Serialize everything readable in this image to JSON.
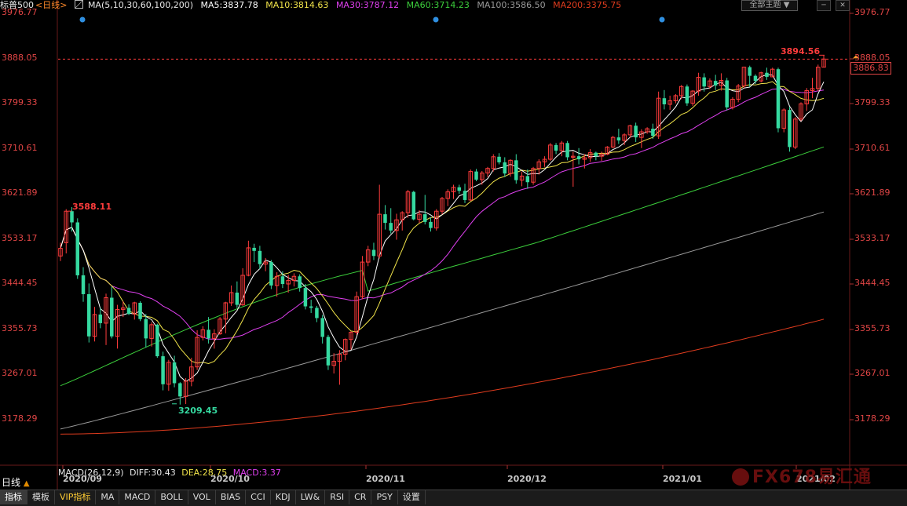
{
  "header": {
    "symbol": "标普500",
    "period_tag": "<日线>",
    "ma_title": "MA(5,10,30,60,100,200)",
    "ma5": "MA5:3837.78",
    "ma10": "MA10:3814.63",
    "ma30": "MA30:3787.12",
    "ma60": "MA60:3714.23",
    "ma100": "MA100:3586.50",
    "ma200": "MA200:3375.75",
    "theme_button": "全部主题",
    "dropdown_glyph": "▼",
    "minimize_glyph": "─",
    "close_glyph": "✕"
  },
  "colors": {
    "up": "#ff3c3c",
    "down": "#35d9a0",
    "ma5": "#ffffff",
    "ma10": "#f0e34a",
    "ma30": "#e040f0",
    "ma60": "#3ccf3c",
    "ma100": "#9a9a9a",
    "ma200": "#e03c1e"
  },
  "y_axis": {
    "ticks": [
      "3976.77",
      "3888.05",
      "3799.33",
      "3710.61",
      "3621.89",
      "3533.17",
      "3444.45",
      "3355.73",
      "3267.01",
      "3178.29"
    ]
  },
  "x_axis": {
    "labels": [
      "2020/09",
      "2020/10",
      "2020/11",
      "2020/12",
      "2021/01",
      "2021/02"
    ]
  },
  "current_price": "3886.83",
  "annotations": {
    "high_label": "3894.56",
    "left_high_label": "3588.11",
    "low_label": "3209.45"
  },
  "macd": {
    "title": "MACD(26,12,9)",
    "diff": "DIFF:30.43",
    "dea": "DEA:28.75",
    "macd": "MACD:3.37"
  },
  "period_label": "日线",
  "period_glyph": "▲",
  "tabs": [
    "指标",
    "模板",
    "VIP指标",
    "MA",
    "MACD",
    "BOLL",
    "VOL",
    "BIAS",
    "CCI",
    "KDJ",
    "LW&",
    "RSI",
    "CR",
    "PSY",
    "设置"
  ],
  "watermark": "FX678易汇通",
  "chart_data": {
    "type": "candlestick",
    "y_range": [
      3130,
      3990
    ],
    "candles": [
      [
        3500,
        3526,
        3490,
        3515
      ],
      [
        3526,
        3592,
        3505,
        3588
      ],
      [
        3588,
        3596,
        3548,
        3566
      ],
      [
        3566,
        3574,
        3455,
        3462
      ],
      [
        3462,
        3478,
        3410,
        3425
      ],
      [
        3425,
        3446,
        3330,
        3342
      ],
      [
        3342,
        3400,
        3332,
        3385
      ],
      [
        3385,
        3398,
        3358,
        3368
      ],
      [
        3368,
        3426,
        3325,
        3418
      ],
      [
        3418,
        3440,
        3338,
        3342
      ],
      [
        3342,
        3404,
        3318,
        3395
      ],
      [
        3395,
        3411,
        3380,
        3398
      ],
      [
        3398,
        3405,
        3384,
        3386
      ],
      [
        3386,
        3410,
        3375,
        3408
      ],
      [
        3408,
        3411,
        3372,
        3376
      ],
      [
        3376,
        3386,
        3320,
        3338
      ],
      [
        3338,
        3370,
        3322,
        3365
      ],
      [
        3365,
        3367,
        3300,
        3303
      ],
      [
        3303,
        3312,
        3236,
        3248
      ],
      [
        3248,
        3296,
        3235,
        3291
      ],
      [
        3291,
        3304,
        3242,
        3250
      ],
      [
        3250,
        3252,
        3208,
        3224
      ],
      [
        3224,
        3260,
        3209,
        3254
      ],
      [
        3254,
        3300,
        3244,
        3282
      ],
      [
        3282,
        3354,
        3276,
        3340
      ],
      [
        3340,
        3362,
        3334,
        3355
      ],
      [
        3355,
        3380,
        3328,
        3338
      ],
      [
        3338,
        3356,
        3318,
        3347
      ],
      [
        3347,
        3380,
        3345,
        3376
      ],
      [
        3376,
        3410,
        3348,
        3408
      ],
      [
        3408,
        3442,
        3402,
        3428
      ],
      [
        3428,
        3450,
        3398,
        3404
      ],
      [
        3404,
        3476,
        3402,
        3462
      ],
      [
        3462,
        3530,
        3460,
        3516
      ],
      [
        3516,
        3524,
        3488,
        3510
      ],
      [
        3510,
        3520,
        3474,
        3484
      ],
      [
        3484,
        3496,
        3470,
        3488
      ],
      [
        3488,
        3492,
        3435,
        3442
      ],
      [
        3442,
        3468,
        3420,
        3460
      ],
      [
        3460,
        3470,
        3437,
        3445
      ],
      [
        3445,
        3463,
        3428,
        3452
      ],
      [
        3452,
        3466,
        3440,
        3460
      ],
      [
        3460,
        3464,
        3430,
        3437
      ],
      [
        3437,
        3445,
        3395,
        3401
      ],
      [
        3401,
        3414,
        3388,
        3398
      ],
      [
        3398,
        3402,
        3370,
        3378
      ],
      [
        3378,
        3384,
        3328,
        3341
      ],
      [
        3341,
        3345,
        3276,
        3285
      ],
      [
        3285,
        3309,
        3269,
        3293
      ],
      [
        3293,
        3315,
        3247,
        3307
      ],
      [
        3307,
        3338,
        3295,
        3336
      ],
      [
        3336,
        3352,
        3316,
        3350
      ],
      [
        3350,
        3430,
        3345,
        3420
      ],
      [
        3420,
        3500,
        3415,
        3488
      ],
      [
        3488,
        3520,
        3480,
        3512
      ],
      [
        3512,
        3526,
        3492,
        3500
      ],
      [
        3500,
        3640,
        3495,
        3582
      ],
      [
        3582,
        3600,
        3552,
        3565
      ],
      [
        3565,
        3594,
        3544,
        3550
      ],
      [
        3550,
        3583,
        3532,
        3571
      ],
      [
        3571,
        3588,
        3550,
        3585
      ],
      [
        3585,
        3630,
        3575,
        3626
      ],
      [
        3626,
        3628,
        3570,
        3572
      ],
      [
        3572,
        3590,
        3565,
        3582
      ],
      [
        3582,
        3620,
        3562,
        3567
      ],
      [
        3567,
        3576,
        3548,
        3555
      ],
      [
        3555,
        3592,
        3550,
        3588
      ],
      [
        3588,
        3616,
        3582,
        3613
      ],
      [
        3613,
        3631,
        3598,
        3626
      ],
      [
        3626,
        3640,
        3612,
        3635
      ],
      [
        3635,
        3640,
        3622,
        3628
      ],
      [
        3628,
        3642,
        3604,
        3610
      ],
      [
        3610,
        3670,
        3608,
        3666
      ],
      [
        3666,
        3671,
        3647,
        3650
      ],
      [
        3650,
        3667,
        3640,
        3663
      ],
      [
        3663,
        3675,
        3655,
        3672
      ],
      [
        3672,
        3700,
        3666,
        3695
      ],
      [
        3695,
        3702,
        3680,
        3684
      ],
      [
        3684,
        3694,
        3655,
        3662
      ],
      [
        3662,
        3690,
        3656,
        3688
      ],
      [
        3688,
        3700,
        3642,
        3649
      ],
      [
        3649,
        3666,
        3637,
        3657
      ],
      [
        3657,
        3670,
        3632,
        3645
      ],
      [
        3645,
        3675,
        3640,
        3672
      ],
      [
        3672,
        3690,
        3660,
        3685
      ],
      [
        3685,
        3696,
        3675,
        3690
      ],
      [
        3690,
        3722,
        3687,
        3718
      ],
      [
        3718,
        3722,
        3700,
        3707
      ],
      [
        3707,
        3726,
        3696,
        3722
      ],
      [
        3722,
        3726,
        3688,
        3694
      ],
      [
        3694,
        3705,
        3636,
        3696
      ],
      [
        3696,
        3712,
        3680,
        3690
      ],
      [
        3690,
        3700,
        3672,
        3693
      ],
      [
        3693,
        3710,
        3685,
        3703
      ],
      [
        3703,
        3705,
        3688,
        3696
      ],
      [
        3696,
        3705,
        3687,
        3700
      ],
      [
        3700,
        3716,
        3698,
        3714
      ],
      [
        3714,
        3736,
        3712,
        3733
      ],
      [
        3733,
        3750,
        3720,
        3727
      ],
      [
        3727,
        3741,
        3718,
        3738
      ],
      [
        3738,
        3758,
        3732,
        3756
      ],
      [
        3756,
        3762,
        3724,
        3733
      ],
      [
        3733,
        3749,
        3712,
        3744
      ],
      [
        3744,
        3753,
        3740,
        3750
      ],
      [
        3750,
        3760,
        3730,
        3736
      ],
      [
        3736,
        3823,
        3730,
        3810
      ],
      [
        3810,
        3826,
        3788,
        3798
      ],
      [
        3798,
        3815,
        3787,
        3805
      ],
      [
        3805,
        3818,
        3800,
        3815
      ],
      [
        3815,
        3836,
        3808,
        3833
      ],
      [
        3833,
        3837,
        3795,
        3800
      ],
      [
        3800,
        3826,
        3795,
        3824
      ],
      [
        3824,
        3860,
        3815,
        3851
      ],
      [
        3851,
        3859,
        3823,
        3833
      ],
      [
        3833,
        3849,
        3828,
        3844
      ],
      [
        3844,
        3856,
        3826,
        3835
      ],
      [
        3835,
        3859,
        3825,
        3845
      ],
      [
        3845,
        3850,
        3786,
        3792
      ],
      [
        3792,
        3812,
        3788,
        3808
      ],
      [
        3808,
        3838,
        3802,
        3834
      ],
      [
        3834,
        3872,
        3830,
        3871
      ],
      [
        3871,
        3874,
        3832,
        3854
      ],
      [
        3854,
        3857,
        3838,
        3844
      ],
      [
        3844,
        3862,
        3841,
        3860
      ],
      [
        3860,
        3870,
        3846,
        3852
      ],
      [
        3852,
        3870,
        3852,
        3867
      ],
      [
        3867,
        3870,
        3743,
        3751
      ],
      [
        3751,
        3790,
        3743,
        3787
      ],
      [
        3787,
        3793,
        3705,
        3714
      ],
      [
        3714,
        3773,
        3710,
        3769
      ],
      [
        3769,
        3802,
        3765,
        3799
      ],
      [
        3799,
        3830,
        3785,
        3825
      ],
      [
        3825,
        3850,
        3810,
        3829
      ],
      [
        3829,
        3876,
        3824,
        3871
      ],
      [
        3871,
        3894.56,
        3871,
        3887
      ]
    ]
  }
}
